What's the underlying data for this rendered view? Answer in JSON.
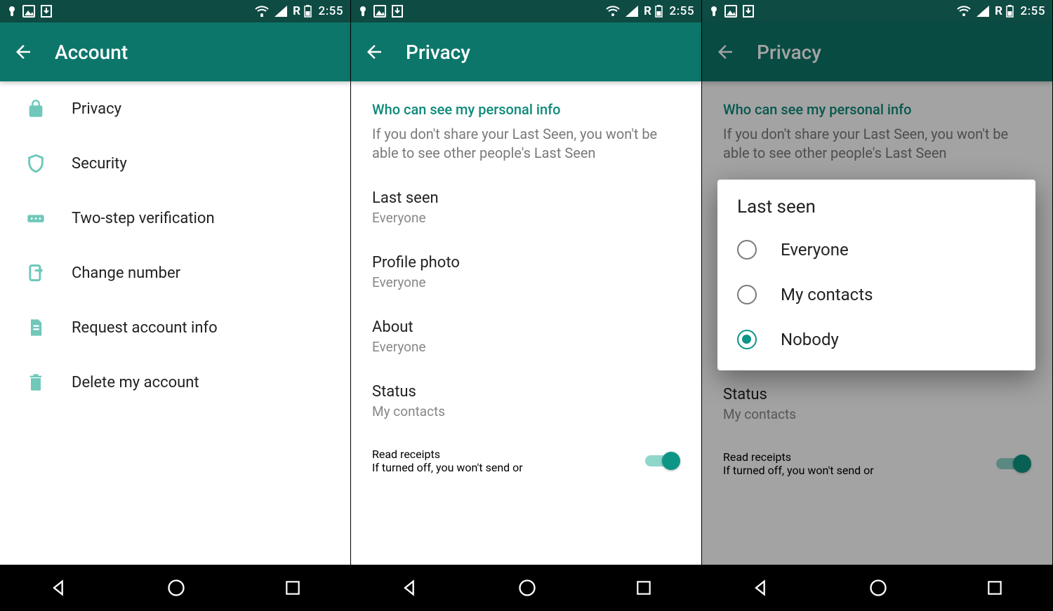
{
  "status": {
    "time": "2:55",
    "roaming": "R"
  },
  "screen1": {
    "title": "Account",
    "items": [
      {
        "label": "Privacy"
      },
      {
        "label": "Security"
      },
      {
        "label": "Two-step verification"
      },
      {
        "label": "Change number"
      },
      {
        "label": "Request account info"
      },
      {
        "label": "Delete my account"
      }
    ]
  },
  "screen2": {
    "title": "Privacy",
    "section_header": "Who can see my personal info",
    "section_desc": "If you don't share your Last Seen, you won't be able to see other people's Last Seen",
    "prefs": [
      {
        "title": "Last seen",
        "sub": "Everyone"
      },
      {
        "title": "Profile photo",
        "sub": "Everyone"
      },
      {
        "title": "About",
        "sub": "Everyone"
      },
      {
        "title": "Status",
        "sub": "My contacts"
      }
    ],
    "read_receipts": {
      "title": "Read receipts",
      "desc": "If turned off, you won't send or"
    }
  },
  "screen3": {
    "title": "Privacy",
    "section_header": "Who can see my personal info",
    "section_desc": "If you don't share your Last Seen, you won't be able to see other people's Last Seen",
    "status_pref": {
      "title": "Status",
      "sub": "My contacts"
    },
    "read_receipts": {
      "title": "Read receipts",
      "desc": "If turned off, you won't send or"
    },
    "dialog": {
      "title": "Last seen",
      "options": [
        {
          "label": "Everyone",
          "checked": false
        },
        {
          "label": "My contacts",
          "checked": false
        },
        {
          "label": "Nobody",
          "checked": true
        }
      ]
    }
  }
}
